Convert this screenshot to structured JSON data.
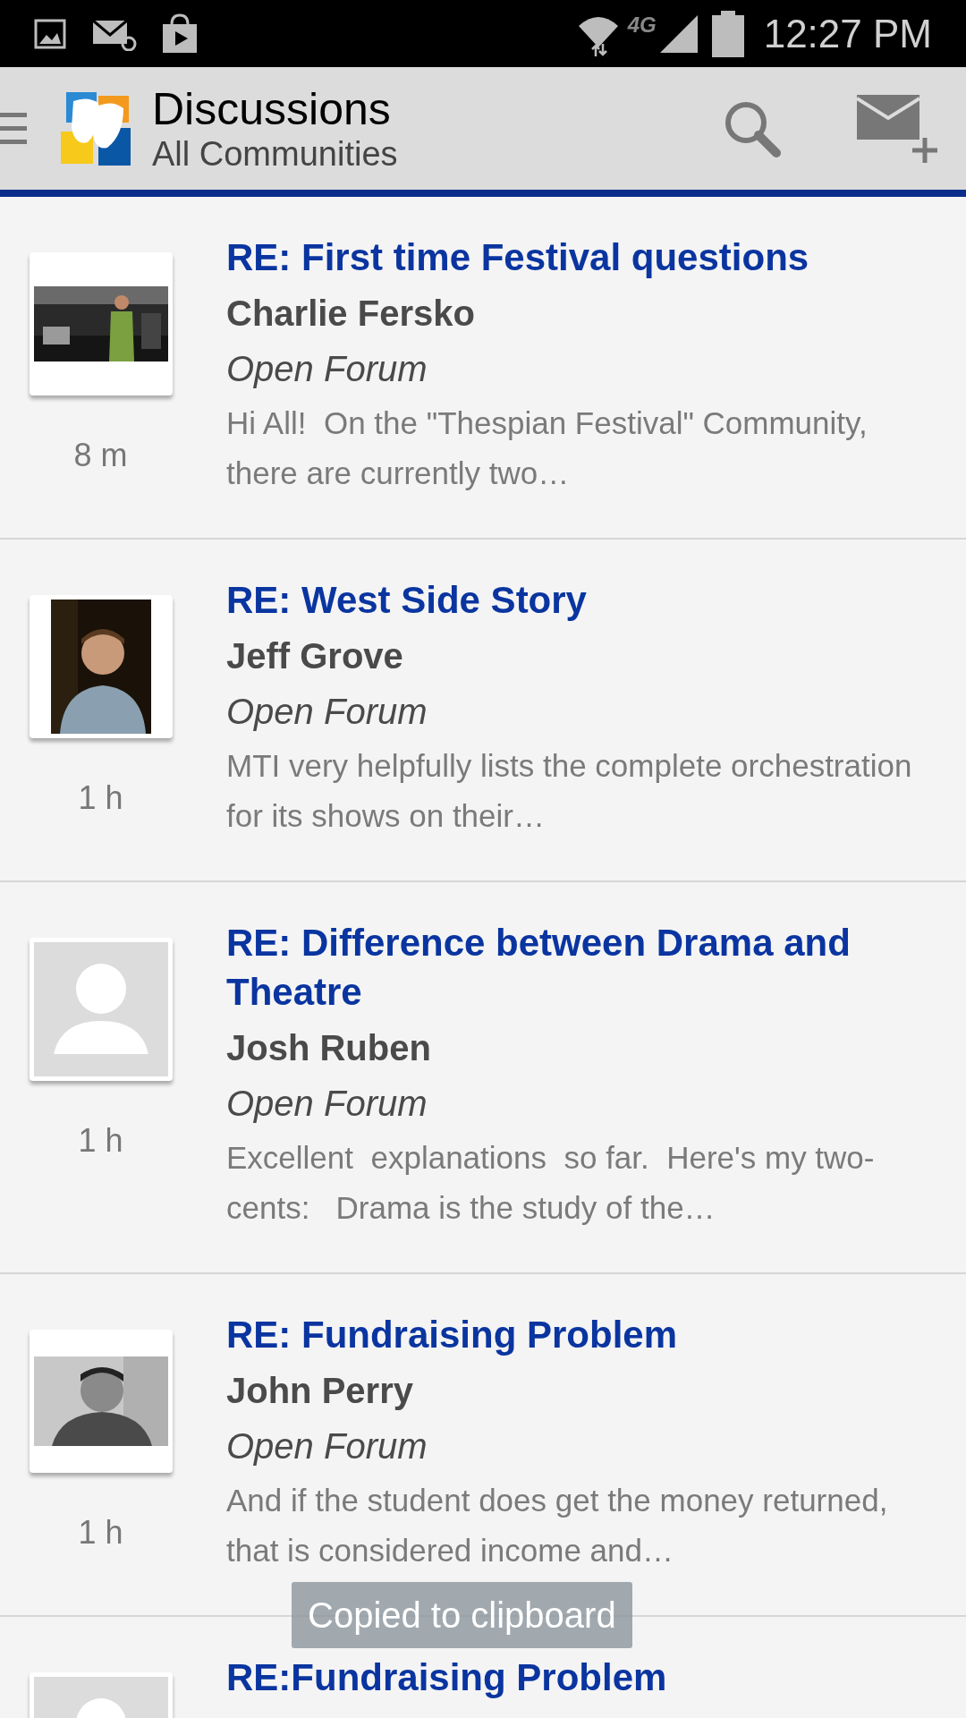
{
  "status_bar": {
    "time": "12:27 PM",
    "network": "4G"
  },
  "app_bar": {
    "title": "Discussions",
    "subtitle": "All Communities"
  },
  "posts": [
    {
      "title": "RE: First time Festival questions",
      "author": "Charlie Fersko",
      "forum": "Open Forum",
      "excerpt": "Hi All!  On the \"Thespian Festival\" Community, there are currently two…",
      "age": "8 m",
      "avatar": {
        "kind": "stage"
      }
    },
    {
      "title": "RE: West Side Story",
      "author": "Jeff Grove",
      "forum": "Open Forum",
      "excerpt": "MTI very helpfully lists the complete orchestration for its shows on their…",
      "age": "1 h",
      "avatar": {
        "kind": "portrait"
      }
    },
    {
      "title": "RE: Difference between Drama and Theatre",
      "author": "Josh Ruben",
      "forum": "Open Forum",
      "excerpt": "Excellent  explanations  so far.  Here's my two-cents:   Drama is the study of the…",
      "age": "1 h",
      "avatar": {
        "kind": "placeholder"
      }
    },
    {
      "title": "RE: Fundraising Problem",
      "author": "John Perry",
      "forum": "Open Forum",
      "excerpt": "And if the student does get the money returned, that is considered income and…",
      "age": "1 h",
      "avatar": {
        "kind": "mono"
      }
    },
    {
      "title": "RE:Fundraising Problem",
      "avatar": {
        "kind": "placeholder"
      }
    }
  ],
  "toast": "Copied to clipboard"
}
